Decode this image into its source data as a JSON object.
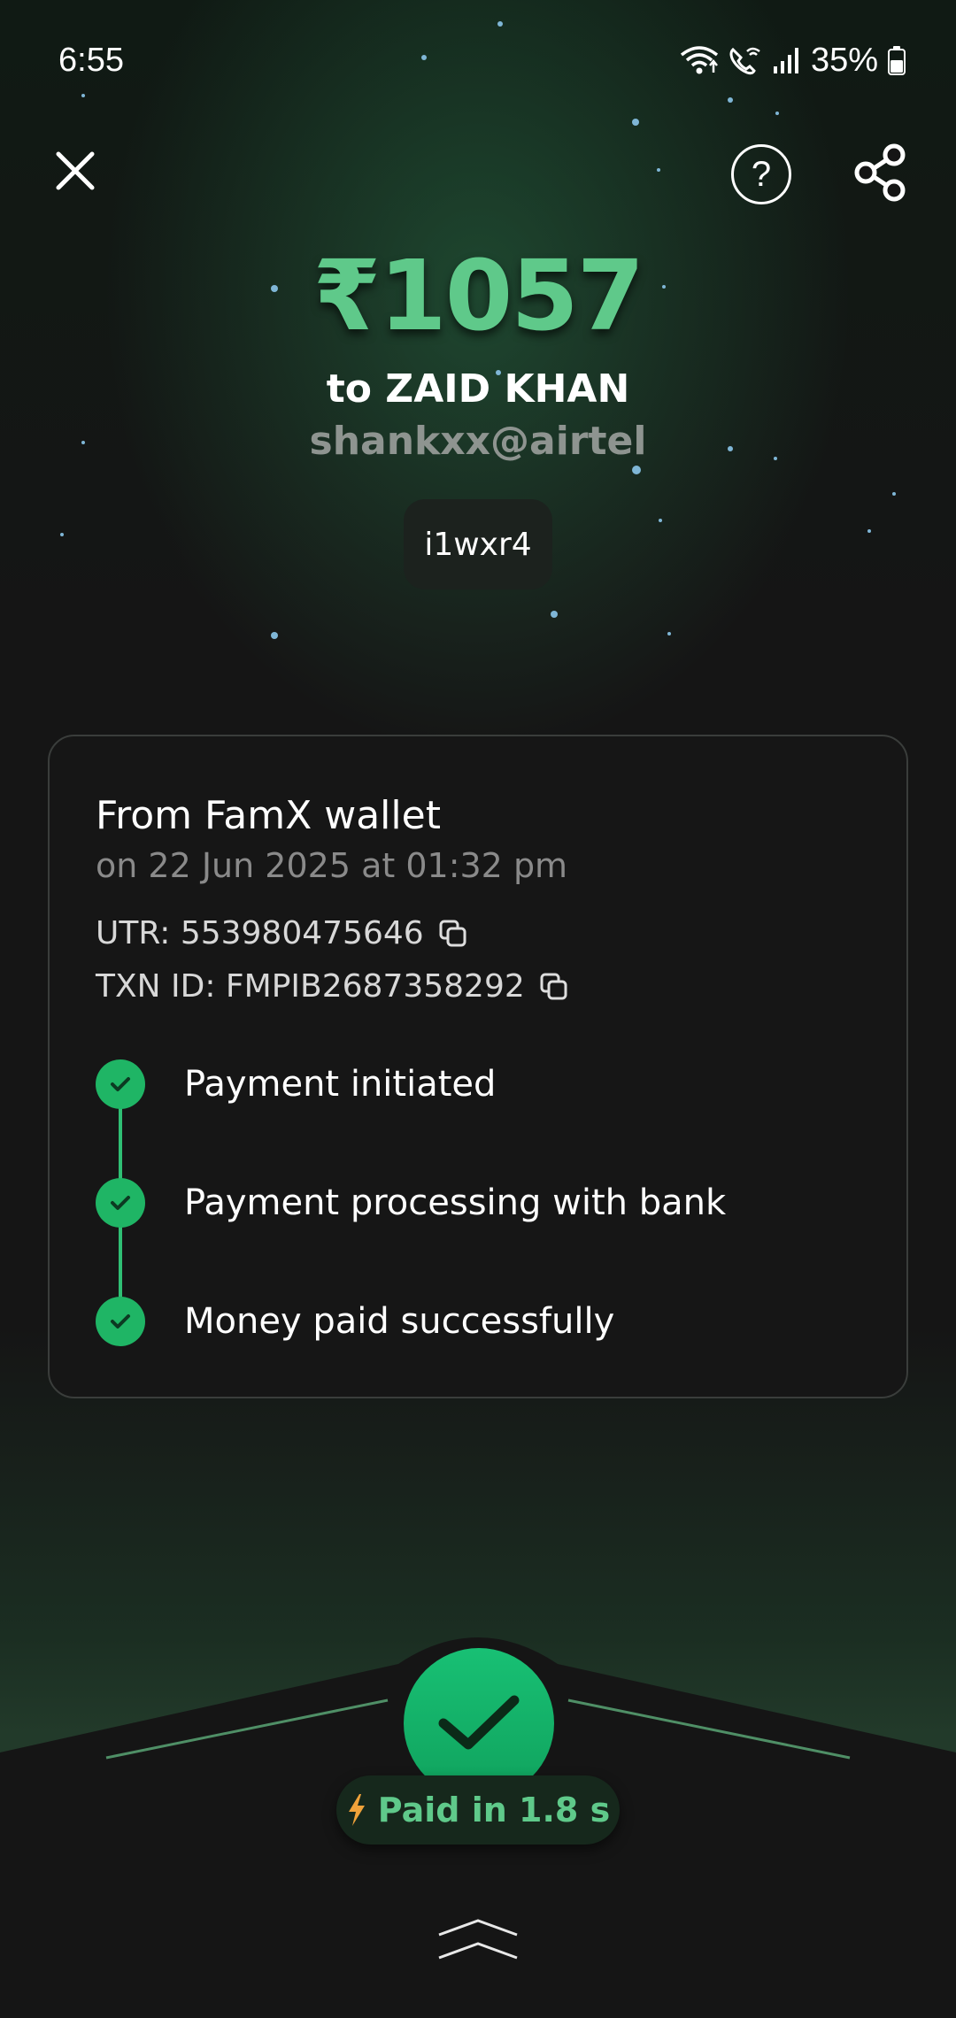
{
  "status_bar": {
    "time": "6:55",
    "battery": "35%",
    "icons": [
      "wifi-icon",
      "wifi-calling-icon",
      "signal-icon",
      "battery-icon"
    ]
  },
  "top_bar": {
    "icons": [
      "close-icon",
      "help-icon",
      "share-icon"
    ],
    "help_glyph": "?"
  },
  "payment": {
    "amount": "₹1057",
    "payee": "to ZAID KHAN",
    "vpa": "shankxx@airtel",
    "note": "i1wxr4"
  },
  "details": {
    "source": "From FamX wallet",
    "datetime": "on 22 Jun 2025 at 01:32 pm",
    "utr": "UTR: 553980475646",
    "txn_id": "TXN ID: FMPIB2687358292",
    "steps": [
      {
        "label": "Payment initiated",
        "status": "done"
      },
      {
        "label": "Payment processing with bank",
        "status": "done"
      },
      {
        "label": "Money paid successfully",
        "status": "done"
      }
    ]
  },
  "footer": {
    "paid_label": "Paid in 1.8 s",
    "icons": [
      "check-icon",
      "lightning-icon",
      "chevron-up-icon"
    ]
  },
  "colors": {
    "accent_green": "#5fc98a",
    "success_green": "#1fb565",
    "background": "#151515",
    "lightning": "#f0a23a"
  }
}
